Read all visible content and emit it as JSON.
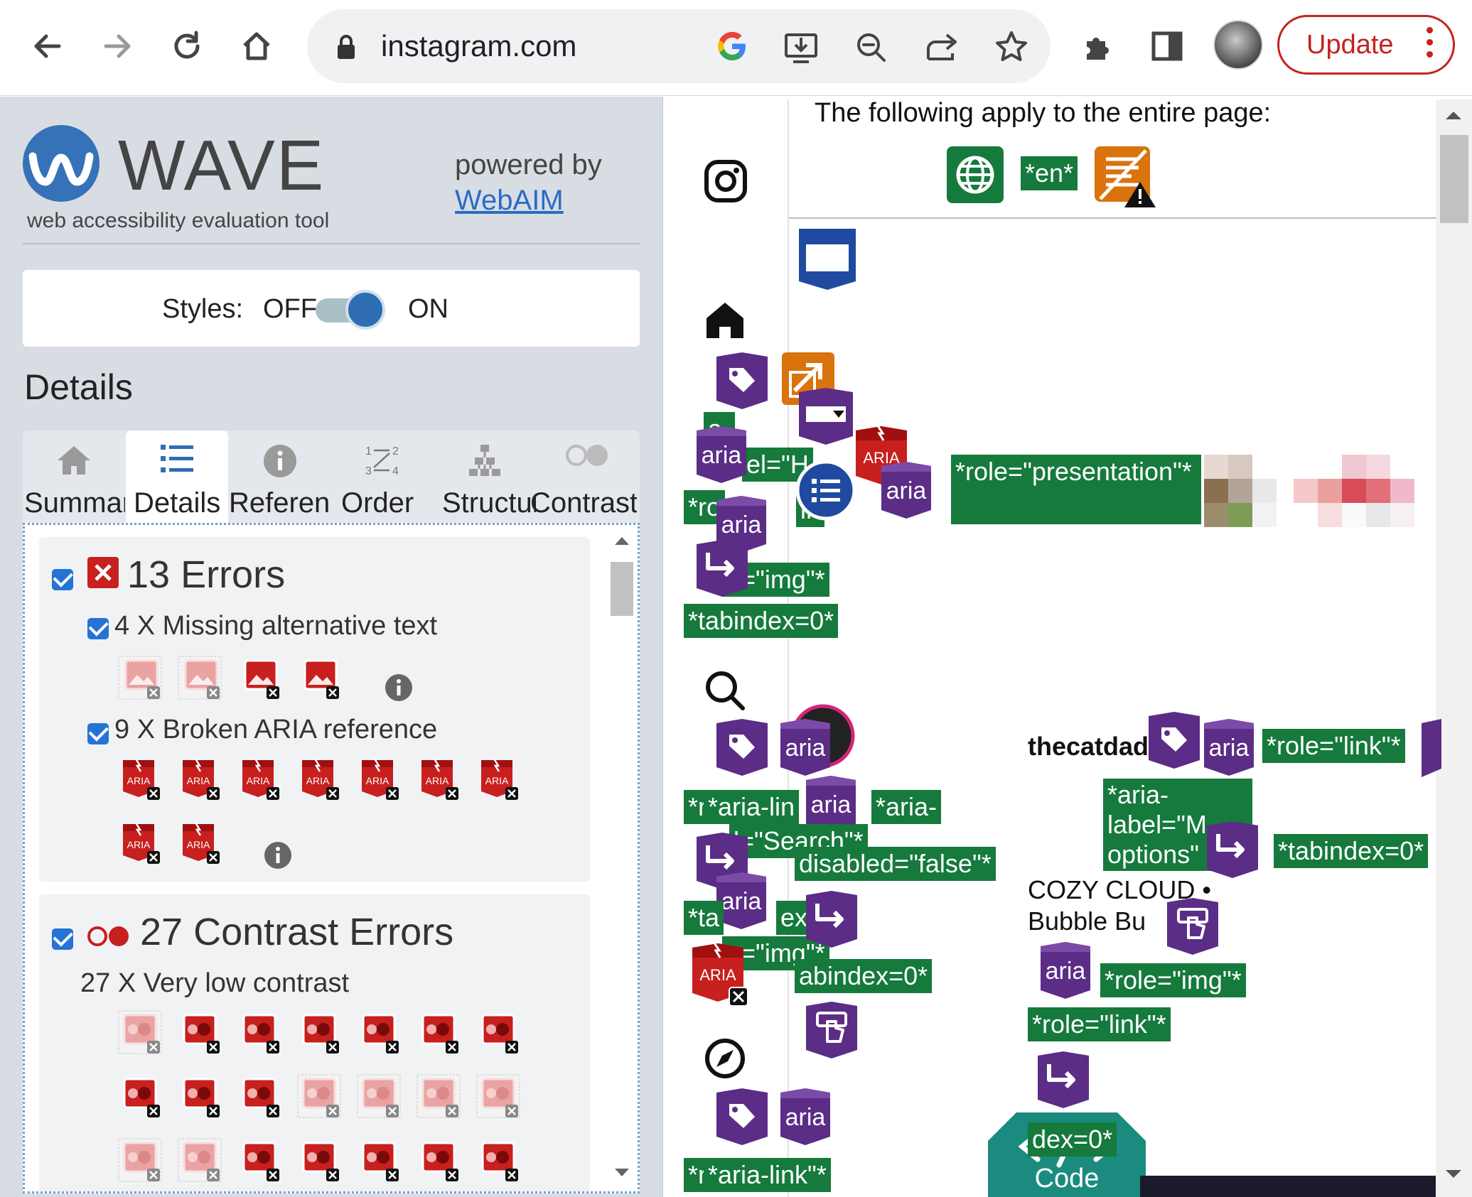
{
  "browser": {
    "url": "instagram.com",
    "update_label": "Update"
  },
  "wave": {
    "title": "WAVE",
    "subtitle": "web accessibility evaluation tool",
    "powered_by": "powered by",
    "webaim_link": "WebAIM",
    "styles": {
      "label": "Styles:",
      "off": "OFF",
      "on": "ON",
      "state": "on"
    },
    "details_heading": "Details",
    "tabs": [
      {
        "label": "Summary",
        "icon": "home-icon"
      },
      {
        "label": "Details",
        "icon": "list-icon",
        "active": true
      },
      {
        "label": "Reference",
        "icon": "info-icon"
      },
      {
        "label": "Order",
        "icon": "order-icon"
      },
      {
        "label": "Structure",
        "icon": "structure-icon"
      },
      {
        "label": "Contrast",
        "icon": "contrast-icon"
      }
    ],
    "errors": {
      "title": "13 Errors",
      "items": [
        {
          "label": "4 X Missing alternative text",
          "count": 4
        },
        {
          "label": "9 X Broken ARIA reference",
          "count": 9
        }
      ]
    },
    "contrast": {
      "title": "27 Contrast Errors",
      "items": [
        {
          "label": "27 X Very low contrast",
          "count": 27
        }
      ]
    },
    "aria_badge": "ARIA"
  },
  "page": {
    "apply_text": "The following apply to the entire page:",
    "lang_tag": "*en*",
    "tags": {
      "role_presentation": "*role=\"presentation\"*",
      "role_img": "*role=\"img\"*",
      "role_img_partial": "e=\"img\"*",
      "tabindex0": "*tabindex=0*",
      "role_link": "*role=\"link\"*",
      "aria_label_search": "l=\"Search\"*",
      "disabled_false": "disabled=\"false\"*",
      "aria_label_m": "*aria-\nlabel=\"M\noptions\"",
      "aria_dash": "*aria-",
      "aria_link": "*aria-link\"*",
      "aria_lin": "*aria-lin",
      "r_frag": "*r",
      "ta_frag": "*ta",
      "tabindex_frag": "abindex=0*",
      "dex_frag": "dex=0*",
      "ex_frag": "ex",
      "a_frag": "a-",
      "hl_frag": "el=\"H",
      "ro_frag": "*ro",
      "in_frag": "in",
      "img2_frag": "e=\"img\"*"
    },
    "aria_word": "aria",
    "username": "thecatdad",
    "post_text_1": "COZY CLOUD •",
    "post_text_2": "Bubble Bu",
    "code_label": "Code"
  },
  "colors": {
    "wave_blue": "#3572b8",
    "error_red": "#c81f1f",
    "aria_purple": "#5b2d86",
    "tag_green": "#157a3c",
    "update_red": "#c5221f"
  }
}
